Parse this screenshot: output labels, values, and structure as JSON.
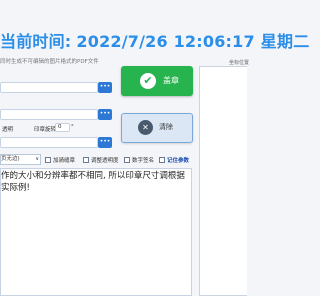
{
  "banner": {
    "prefix": "当前时间:",
    "datetime": "2022/7/26 12:06:17",
    "weekday": "星期二"
  },
  "hint": "同时生成不可编辑的图片格式的PDF文件",
  "inputs": {
    "dots": "•••"
  },
  "stamp_button": {
    "label": "盖章",
    "icon": "check-icon"
  },
  "clear_button": {
    "label": "清除",
    "icon": "close-icon"
  },
  "options": {
    "transparent_label": "透明",
    "rotate_label": "印章旋转",
    "rotate_value": "0",
    "rotate_unit": "°",
    "mode_value": "页无边)",
    "add_watermark": "加骑缝章",
    "adjust_transparency": "调整透明度",
    "digital_signature": "数字签名",
    "remember_params": "记住参数"
  },
  "preview_title": "坐标位置",
  "note": "作的大小和分辨率都不相同, 所以印章尺寸调根据实际例!",
  "colors": {
    "accent": "#2b8ee8",
    "stamp": "#27b44f",
    "dots_button": "#2d78d4",
    "remember": "#1f4fb5"
  }
}
